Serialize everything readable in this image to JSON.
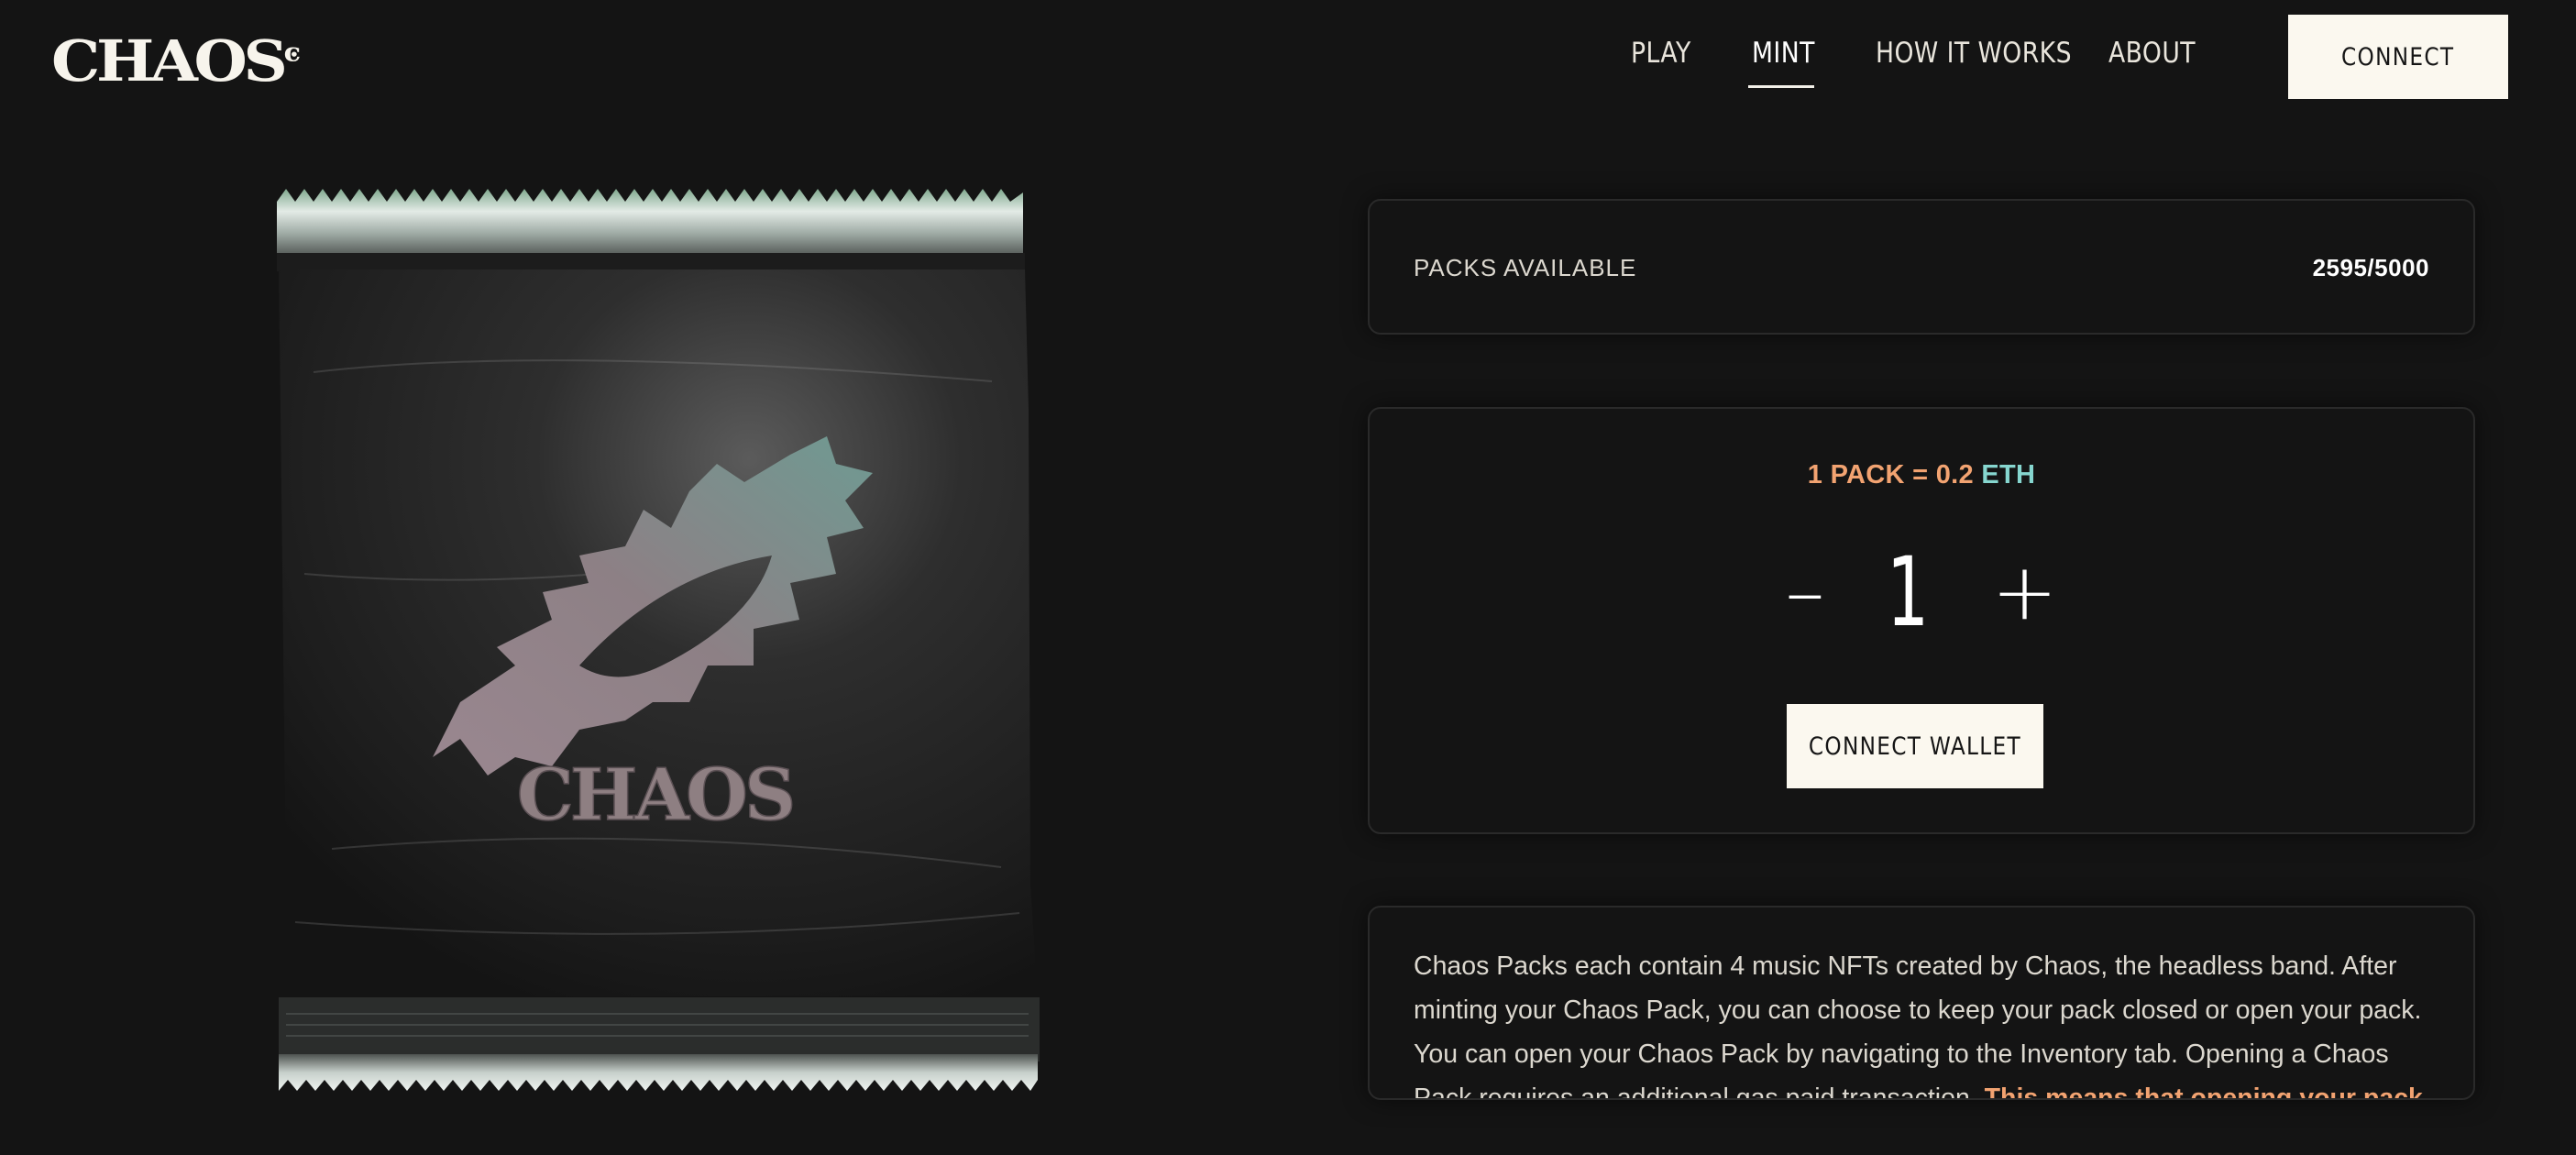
{
  "header": {
    "logo": "CHAOS",
    "nav": [
      {
        "label": "PLAY",
        "active": false
      },
      {
        "label": "MINT",
        "active": true
      },
      {
        "label": "HOW IT WORKS",
        "active": false
      },
      {
        "label": "ABOUT",
        "active": false
      }
    ],
    "connect_label": "CONNECT"
  },
  "pack_image": {
    "wordmark": "CHAOS",
    "colors": {
      "foil": "#232323",
      "logo": "#8e7f82",
      "crimp": "#cfd8d3"
    }
  },
  "availability": {
    "label": "PACKS AVAILABLE",
    "value": "2595/5000"
  },
  "mint": {
    "price_prefix": "1 PACK = 0.2",
    "price_currency": "ETH",
    "minus_symbol": "–",
    "quantity": "1",
    "plus_symbol": "+",
    "button_label": "CONNECT WALLET"
  },
  "description": {
    "text": "Chaos Packs each contain 4 music NFTs created by Chaos, the headless band. After minting your Chaos Pack, you can choose to keep your pack closed or open your pack. You can open your Chaos Pack by navigating to the Inventory tab.  Opening a Chaos Pack requires an additional gas paid transaction.",
    "highlight": "This means that opening your pack will cost you a fee."
  },
  "colors": {
    "background": "#141414",
    "accent_orange": "#f2a371",
    "accent_teal": "#86d6cf",
    "button_bg": "#fbf8ef"
  }
}
